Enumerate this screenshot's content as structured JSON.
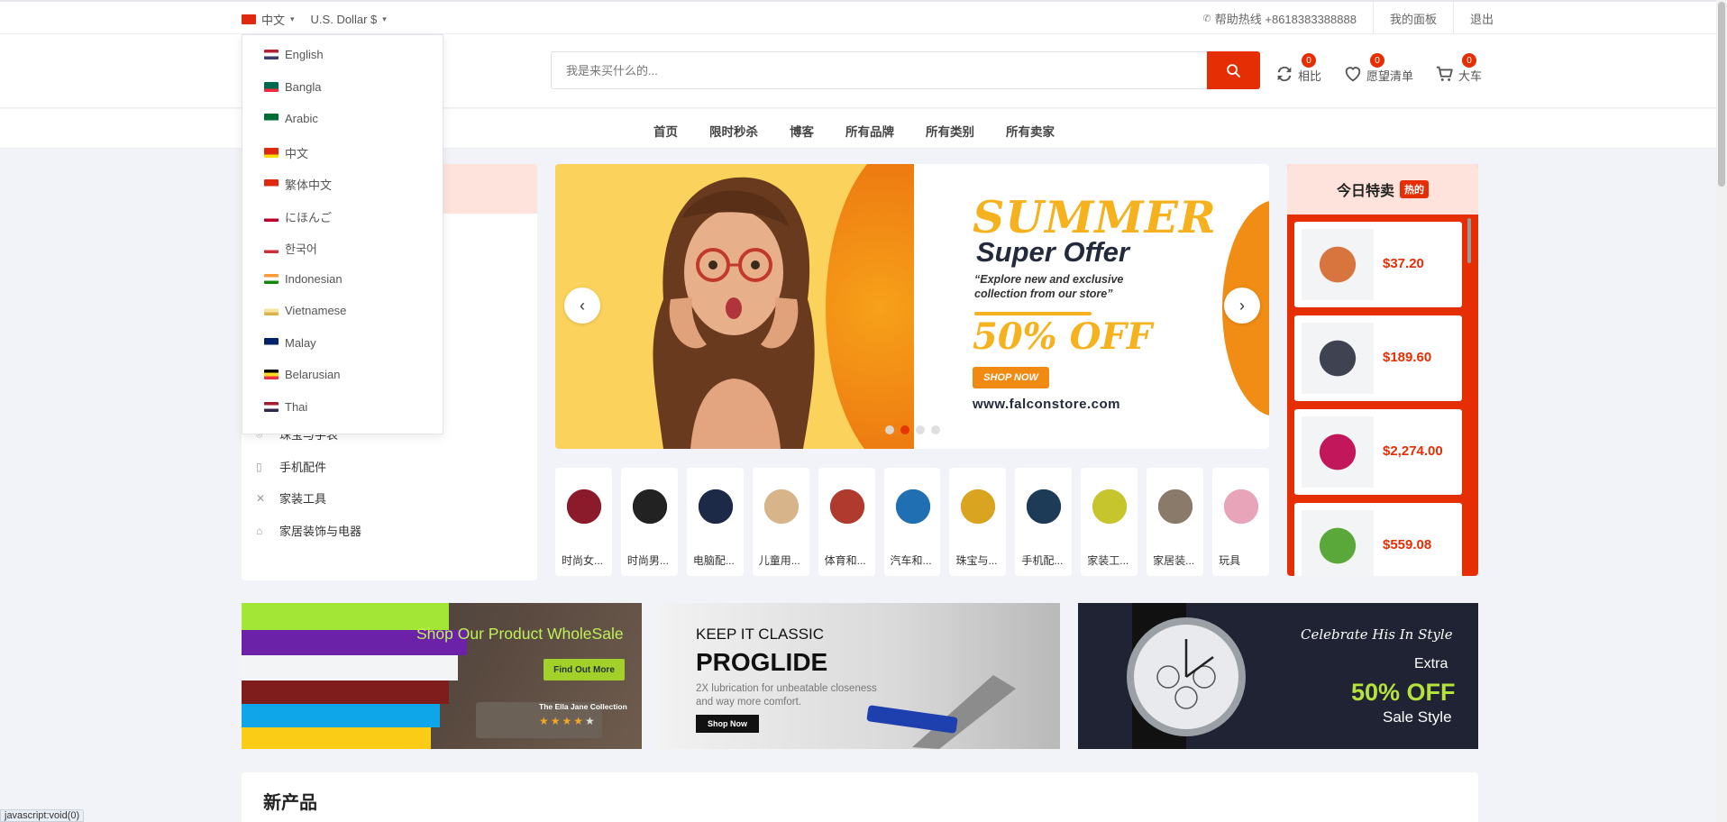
{
  "topbar": {
    "language": "中文",
    "currency": "U.S. Dollar $",
    "hotline": "帮助热线 +8618383388888",
    "dashboard": "我的面板",
    "logout": "退出"
  },
  "search": {
    "placeholder": "我是来买什么的..."
  },
  "header_icons": {
    "compare": {
      "label": "相比",
      "count": "0"
    },
    "wishlist": {
      "label": "愿望清单",
      "count": "0"
    },
    "cart": {
      "label": "大车",
      "count": "0"
    }
  },
  "nav": [
    "首页",
    "限时秒杀",
    "博客",
    "所有品牌",
    "所有类别",
    "所有卖家"
  ],
  "language_dropdown": [
    {
      "label": "English",
      "flag": [
        "#b22234",
        "#fff",
        "#3c3b6e"
      ]
    },
    {
      "label": "Bangla",
      "flag": [
        "#006a4e",
        "#006a4e",
        "#f42a41"
      ]
    },
    {
      "label": "Arabic",
      "flag": [
        "#006c35",
        "#006c35",
        "#fff"
      ]
    },
    {
      "label": "中文",
      "flag": [
        "#de2910",
        "#de2910",
        "#ffde00"
      ]
    },
    {
      "label": "繁体中文",
      "flag": [
        "#de2910",
        "#de2910",
        "#fff"
      ]
    },
    {
      "label": "にほんご",
      "flag": [
        "#fff",
        "#fff",
        "#bc002d"
      ]
    },
    {
      "label": "한국어",
      "flag": [
        "#fff",
        "#fff",
        "#cd2e3a"
      ]
    },
    {
      "label": "Indonesian",
      "flag": [
        "#ff9933",
        "#fff",
        "#138808"
      ]
    },
    {
      "label": "Vietnamese",
      "flag": [
        "#fff",
        "#f7e4a1",
        "#d9b34a"
      ]
    },
    {
      "label": "Malay",
      "flag": [
        "#012169",
        "#012169",
        "#fff"
      ]
    },
    {
      "label": "Belarusian",
      "flag": [
        "#000",
        "#fdda24",
        "#ef3340"
      ]
    },
    {
      "label": "Thai",
      "flag": [
        "#a51931",
        "#fff",
        "#2d2a4a"
      ]
    }
  ],
  "sidebar_categories": [
    {
      "label": "珠宝与手表",
      "icon": "ring-icon"
    },
    {
      "label": "手机配件",
      "icon": "phone-icon"
    },
    {
      "label": "家装工具",
      "icon": "tools-icon"
    },
    {
      "label": "家居装饰与电器",
      "icon": "home-decor-icon"
    }
  ],
  "slider": {
    "summer": "SUMMER",
    "super_offer": "Super Offer",
    "explore": "“Explore new and exclusive collection from our store”",
    "discount": "50% OFF",
    "shop_now": "SHOP NOW",
    "url": "www.falconstore.com",
    "slide_count": 4,
    "active_slide": 2
  },
  "category_strip": [
    {
      "label": "时尚女...",
      "color": "#8b1a2b"
    },
    {
      "label": "时尚男...",
      "color": "#222222"
    },
    {
      "label": "电脑配...",
      "color": "#1c2a48"
    },
    {
      "label": "儿童用...",
      "color": "#d8b48a"
    },
    {
      "label": "体育和...",
      "color": "#b03a2e"
    },
    {
      "label": "汽车和...",
      "color": "#1f6fb2"
    },
    {
      "label": "珠宝与...",
      "color": "#d9a520"
    },
    {
      "label": "手机配...",
      "color": "#1d3b57"
    },
    {
      "label": "家装工...",
      "color": "#c7c52e"
    },
    {
      "label": "家居装...",
      "color": "#8a7a6a"
    },
    {
      "label": "玩具",
      "color": "#e8a4b8"
    }
  ],
  "today_deals": {
    "title": "今日特卖",
    "badge": "热的",
    "items": [
      {
        "price": "$37.20",
        "color": "#d8753e"
      },
      {
        "price": "$189.60",
        "color": "#3f4250"
      },
      {
        "price": "$2,274.00",
        "color": "#c2185b"
      },
      {
        "price": "$559.08",
        "color": "#5aa83a"
      }
    ]
  },
  "promos": {
    "p1": {
      "title": "Shop Our Product WholeSale",
      "button": "Find Out More",
      "brand": "The Ella Jane Collection"
    },
    "p2": {
      "kicker": "KEEP IT CLASSIC",
      "title": "PROGLIDE",
      "desc": "2X lubrication for unbeatable closeness and way more comfort.",
      "button": "Shop Now"
    },
    "p3": {
      "script": "Celebrate His In Style",
      "extra": "Extra",
      "off": "50% OFF",
      "sale": "Sale Style"
    }
  },
  "new_products_title": "新产品",
  "status_bar": "javascript:void(0)",
  "colors": {
    "accent": "#e62e04",
    "soft": "#fde3dc"
  }
}
